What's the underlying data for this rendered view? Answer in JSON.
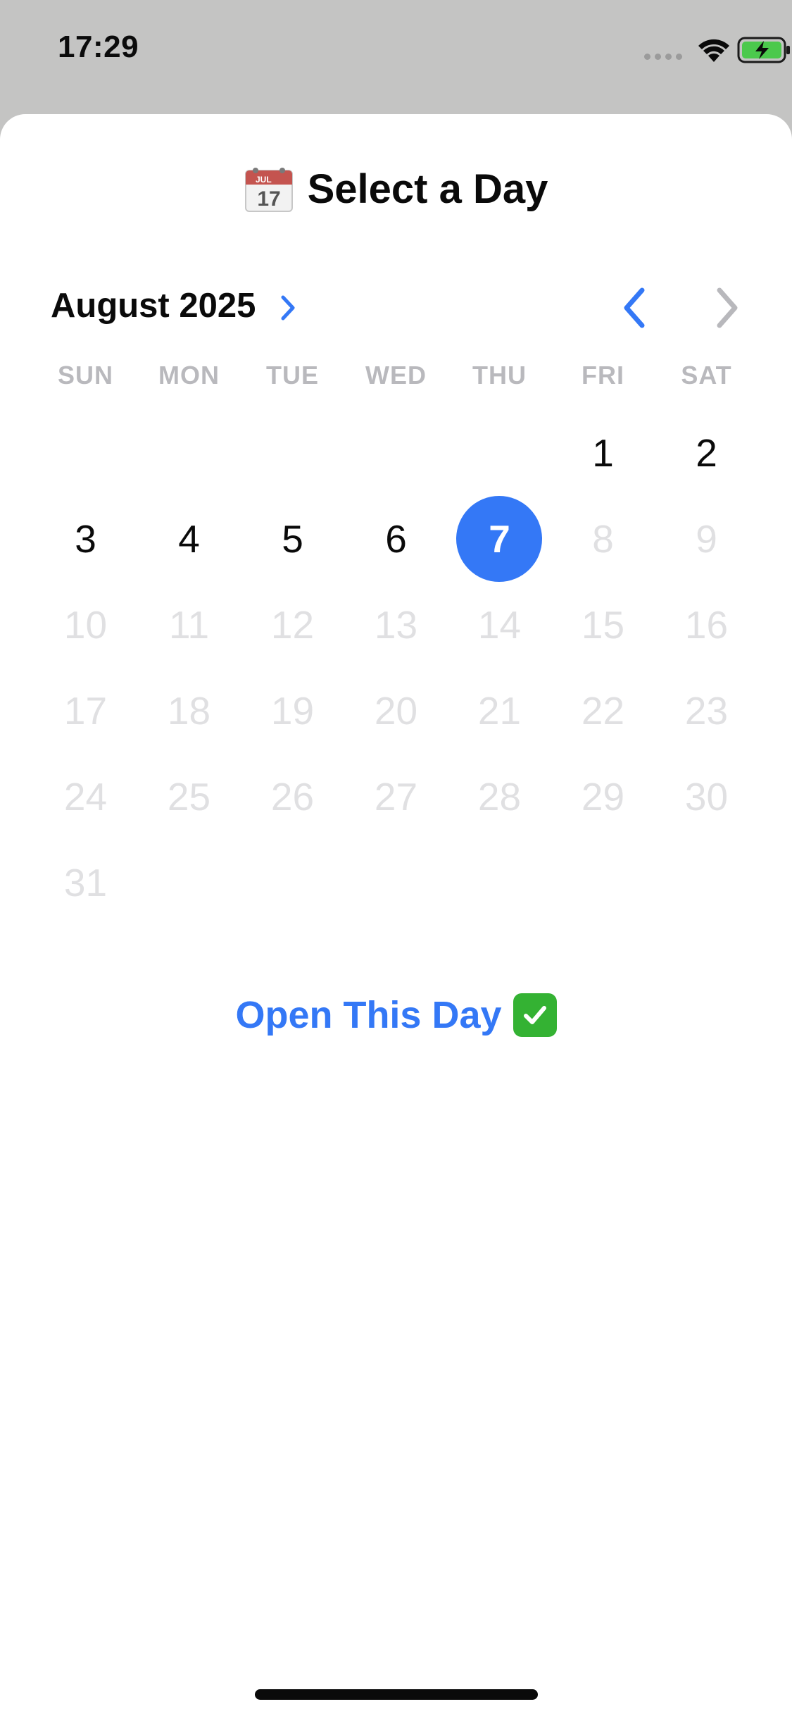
{
  "status_bar": {
    "time": "17:29",
    "icons": [
      "cellular-signal-icon",
      "wifi-icon",
      "battery-charging-icon"
    ]
  },
  "sheet": {
    "title": "Select a Day",
    "title_icon": "calendar-icon",
    "title_icon_text": {
      "month": "JUL",
      "day": "17"
    }
  },
  "calendar": {
    "month_label": "August 2025",
    "weekdays": [
      "SUN",
      "MON",
      "TUE",
      "WED",
      "THU",
      "FRI",
      "SAT"
    ],
    "first_weekday_index": 5,
    "days_in_month": 31,
    "max_enabled_day": 7,
    "selected_day": 7,
    "accent_color": "#3478f6",
    "disabled_color": "#e0e0e2"
  },
  "action": {
    "label": "Open This Day",
    "icon": "check-mark-icon"
  }
}
